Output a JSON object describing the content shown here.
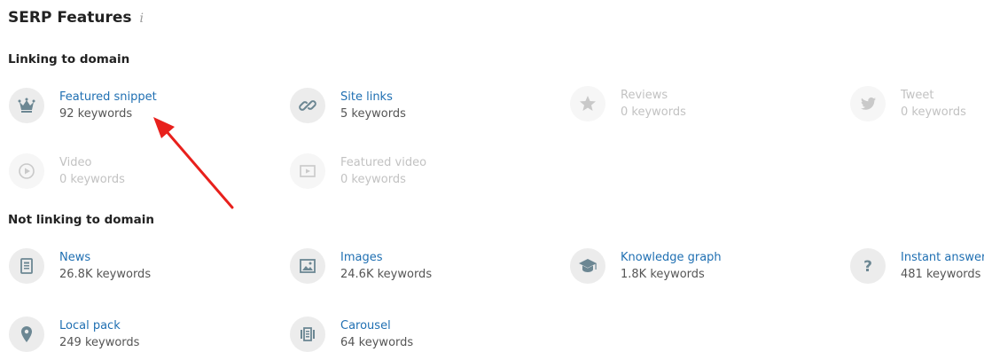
{
  "title": "SERP Features",
  "info_symbol": "i",
  "sections": {
    "linking": "Linking to domain",
    "not_linking": "Not linking to domain"
  },
  "linking": [
    {
      "name": "Featured snippet",
      "count": "92 keywords",
      "icon": "crown-icon"
    },
    {
      "name": "Site links",
      "count": "5 keywords",
      "icon": "link-icon"
    },
    {
      "name": "Reviews",
      "count": "0 keywords",
      "icon": "star-icon"
    },
    {
      "name": "Tweet",
      "count": "0 keywords",
      "icon": "twitter-icon"
    },
    {
      "name": "Video",
      "count": "0 keywords",
      "icon": "play-circle-icon"
    },
    {
      "name": "Featured video",
      "count": "0 keywords",
      "icon": "video-frame-icon"
    }
  ],
  "not_linking": [
    {
      "name": "News",
      "count": "26.8K keywords",
      "icon": "news-icon"
    },
    {
      "name": "Images",
      "count": "24.6K keywords",
      "icon": "image-icon"
    },
    {
      "name": "Knowledge graph",
      "count": "1.8K keywords",
      "icon": "graduation-cap-icon"
    },
    {
      "name": "Instant answer",
      "count": "481 keywords",
      "icon": "question-icon"
    },
    {
      "name": "Local pack",
      "count": "249 keywords",
      "icon": "map-pin-icon"
    },
    {
      "name": "Carousel",
      "count": "64 keywords",
      "icon": "carousel-icon"
    }
  ],
  "colors": {
    "link": "#1f6fb2",
    "muted": "#c2c2c2",
    "annotation_arrow": "#e8201c"
  }
}
